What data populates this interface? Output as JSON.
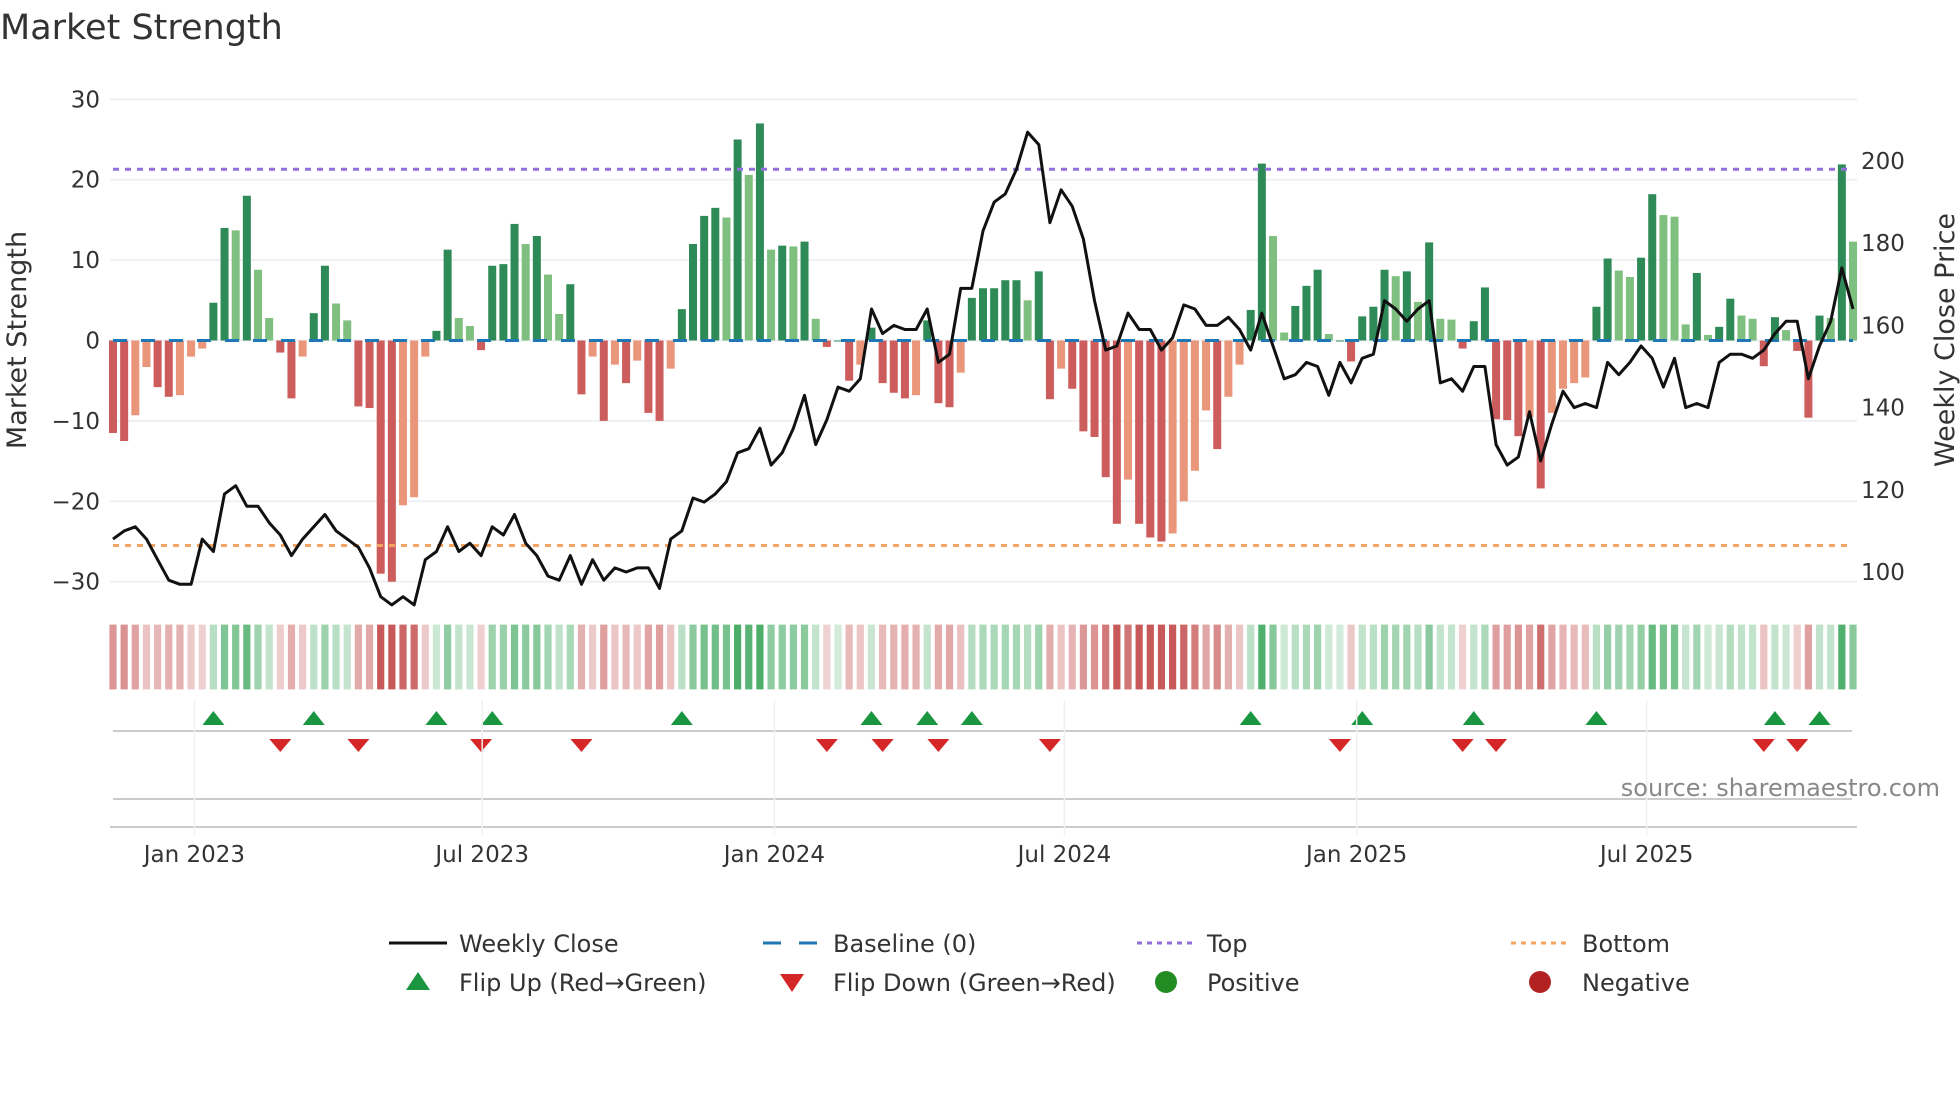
{
  "title": "Market Strength",
  "source": "source: sharemaestro.com",
  "colors": {
    "pos_strong": "#2e8b57",
    "pos_weak": "#7fbf7f",
    "neg_strong": "#cd5c5c",
    "neg_weak": "#e9967a",
    "baseline": "#1f77b4",
    "top": "#9370db",
    "bottom": "#f4a460",
    "flip_up": "#1a9641",
    "flip_down": "#d62728",
    "positive": "#228b22",
    "negative": "#b22222",
    "close": "#111111"
  },
  "chart_data": {
    "type": "bar",
    "title": "Market Strength",
    "ylabel": "Market Strength",
    "y2label": "Weekly Close Price",
    "ylim": [
      -32,
      32
    ],
    "y2lim": [
      96,
      222
    ],
    "yticks": [
      "30",
      "20",
      "10",
      "0",
      "−10",
      "−20",
      "−30"
    ],
    "y2ticks": [
      "200",
      "180",
      "160",
      "140",
      "120",
      "100"
    ],
    "xticks": [
      "Jan 2023",
      "Jul 2023",
      "Jan 2024",
      "Jul 2024",
      "Jan 2025",
      "Jul 2025"
    ],
    "top_level": 21.3,
    "bottom_level": -25.5,
    "baseline": 0,
    "strength": [
      -11.5,
      -12.5,
      -9.3,
      -3.3,
      -5.8,
      -7,
      -6.8,
      -2,
      -1,
      4.7,
      14,
      13.7,
      18,
      8.8,
      2.8,
      -1.5,
      -7.2,
      -2,
      3.4,
      9.3,
      4.6,
      2.5,
      -8.2,
      -8.4,
      -29,
      -30,
      -20.5,
      -19.5,
      -2,
      1.2,
      11.3,
      2.8,
      1.8,
      -1.2,
      9.3,
      9.5,
      14.5,
      12,
      13,
      8.2,
      3.3,
      7,
      -6.7,
      -2,
      -10,
      -3,
      -5.3,
      -2.5,
      -9,
      -10,
      -3.5,
      3.9,
      12,
      15.5,
      16.5,
      15.3,
      25,
      20.6,
      27,
      11.3,
      11.8,
      11.7,
      12.3,
      2.7,
      -0.8,
      0,
      -5,
      -3,
      1.6,
      -5.3,
      -6.5,
      -7.2,
      -6.8,
      2.5,
      -7.8,
      -8.3,
      -4,
      5.3,
      6.5,
      6.5,
      7.5,
      7.5,
      5,
      8.6,
      -7.3,
      -3.5,
      -6,
      -11.3,
      -12,
      -17,
      -22.8,
      -17.3,
      -22.8,
      -24.5,
      -25,
      -24,
      -20,
      -16.2,
      -8.7,
      -13.5,
      -7,
      -3,
      3.8,
      22,
      13,
      1,
      4.3,
      6.8,
      8.8,
      0.8,
      0,
      -2.6,
      3,
      4.2,
      8.8,
      8,
      8.6,
      4.8,
      12.2,
      2.7,
      2.6,
      -1,
      2.4,
      6.6,
      -9.8,
      -9.9,
      -11.9,
      -9.5,
      -18.4,
      -9,
      -6,
      -5.3,
      -4.6,
      4.2,
      10.2,
      8.7,
      7.9,
      10.3,
      18.2,
      15.6,
      15.4,
      2,
      8.4,
      0.7,
      1.7,
      5.2,
      3.1,
      2.7,
      -3.2,
      2.9,
      1.3,
      -1.3,
      -9.6,
      3.1,
      2.8,
      21.9,
      12.3
    ],
    "weekly_close": [
      108,
      110,
      111,
      108,
      103,
      98,
      97,
      97,
      108,
      105,
      119,
      121,
      116,
      116,
      112,
      109,
      104,
      108,
      111,
      114,
      110,
      108,
      106,
      101,
      94,
      92,
      94,
      92,
      103,
      105,
      111,
      105,
      107,
      104,
      111,
      109,
      114,
      107,
      104,
      99,
      98,
      104,
      97,
      103,
      98,
      101,
      100,
      101,
      101,
      96,
      108,
      110,
      118,
      117,
      119,
      122,
      129,
      130,
      135,
      126,
      129,
      135,
      143,
      131,
      137,
      145,
      144,
      147,
      164,
      158,
      160,
      159,
      159,
      164,
      151,
      153,
      169,
      169,
      183,
      190,
      192,
      198,
      207,
      204,
      185,
      193,
      189,
      181,
      166,
      154,
      155,
      163,
      159,
      159,
      154,
      157,
      165,
      164,
      160,
      160,
      162,
      159,
      154,
      163,
      155,
      147,
      148,
      151,
      150,
      143,
      151,
      146,
      152,
      153,
      166,
      164,
      161,
      164,
      166,
      146,
      147,
      144,
      150,
      150,
      131,
      126,
      128,
      139,
      127,
      136,
      144,
      140,
      141,
      140,
      151,
      148,
      151,
      155,
      152,
      145,
      152,
      140,
      141,
      140,
      151,
      153,
      153,
      152,
      154,
      158,
      161,
      161,
      147,
      155,
      161,
      174,
      164
    ],
    "flip_up_weeks": [
      9,
      18,
      29,
      34,
      51,
      68,
      73,
      77,
      102,
      112,
      122,
      133,
      149,
      153
    ],
    "flip_down_weeks": [
      15,
      22,
      33,
      42,
      64,
      69,
      74,
      84,
      110,
      121,
      124,
      148,
      151
    ]
  },
  "legend": [
    {
      "label": "Weekly Close",
      "icon": "solid-line-icon"
    },
    {
      "label": "Baseline (0)",
      "icon": "dashed-line-icon"
    },
    {
      "label": "Top",
      "icon": "dotted-line-icon"
    },
    {
      "label": "Bottom",
      "icon": "dotted-line-icon"
    },
    {
      "label": "Flip Up (Red→Green)",
      "icon": "triangle-up-icon"
    },
    {
      "label": "Flip Down (Green→Red)",
      "icon": "triangle-down-icon"
    },
    {
      "label": "Positive",
      "icon": "circle-icon"
    },
    {
      "label": "Negative",
      "icon": "circle-icon"
    }
  ]
}
